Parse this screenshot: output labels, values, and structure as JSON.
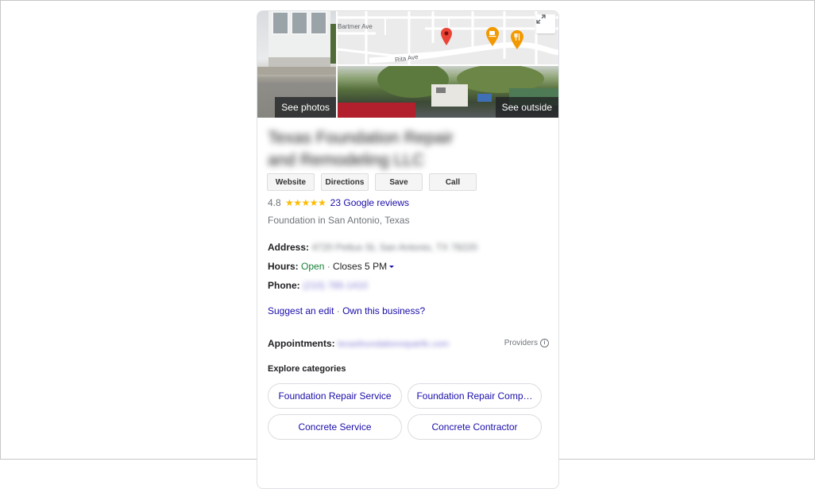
{
  "card": {
    "photos": {
      "see_photos_label": "See photos",
      "see_outside_label": "See outside",
      "map": {
        "street_labels": [
          "Bartmer Ave",
          "Rita Ave"
        ],
        "pins": [
          {
            "icon": "location-pin-icon",
            "color": "#ea4335"
          },
          {
            "icon": "cafe-pin-icon",
            "color": "#f29900"
          },
          {
            "icon": "restaurant-pin-icon",
            "color": "#f29900"
          }
        ],
        "expand_icon": "expand-icon"
      }
    },
    "business_name": "Texas Foundation Repair and Remodeling LLC",
    "actions": [
      {
        "label": "Website"
      },
      {
        "label": "Directions"
      },
      {
        "label": "Save"
      },
      {
        "label": "Call"
      }
    ],
    "rating": {
      "value": "4.8",
      "stars": "★★★★★",
      "reviews_link": "23 Google reviews"
    },
    "category_line": "Foundation in San Antonio, Texas",
    "address": {
      "label": "Address:",
      "value": "4720 Pettus St, San Antonio, TX 78220"
    },
    "hours": {
      "label": "Hours:",
      "status": "Open",
      "separator": " · ",
      "detail": "Closes 5 PM"
    },
    "phone": {
      "label": "Phone:",
      "value": "(210) 785-1410"
    },
    "edit_links": {
      "suggest": "Suggest an edit",
      "separator": " · ",
      "own": "Own this business?"
    },
    "appointments": {
      "label": "Appointments:",
      "value": "texasfoundationrepairllc.com",
      "providers_label": "Providers"
    },
    "explore": {
      "title": "Explore categories",
      "chips": [
        "Foundation Repair Service",
        "Foundation Repair Comp…",
        "Concrete Service",
        "Concrete Contractor"
      ]
    },
    "colors": {
      "link": "#1a0dab",
      "open": "#188038",
      "star": "#fbbc04"
    }
  }
}
